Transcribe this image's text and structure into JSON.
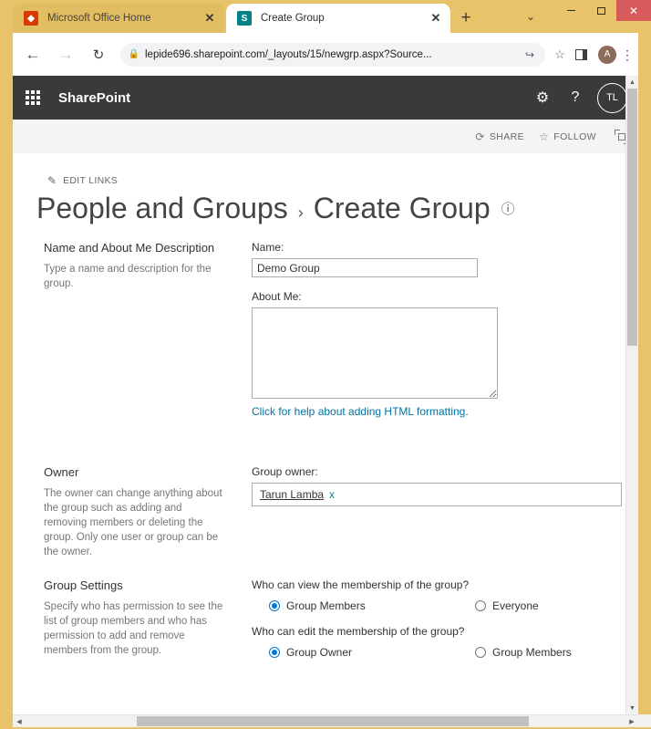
{
  "window": {
    "minimize_label": "—",
    "maximize_label": "□",
    "close_label": "✕"
  },
  "tabs": [
    {
      "title": "Microsoft Office Home",
      "favicon": "office-icon",
      "favicon_letter": "◆",
      "close_label": "✕",
      "active": false
    },
    {
      "title": "Create Group",
      "favicon": "sharepoint-icon",
      "favicon_letter": "S",
      "close_label": "✕",
      "active": true
    }
  ],
  "tabstrip": {
    "new_tab_label": "+",
    "tab_list_label": "⌄"
  },
  "toolbar": {
    "back_label": "←",
    "forward_label": "→",
    "reload_label": "↻",
    "lock_label": "🔒",
    "url": "lepide696.sharepoint.com/_layouts/15/newgrp.aspx?Source...",
    "share_label": "↪",
    "star_label": "☆",
    "profile_initial": "A",
    "kebab_label": "⋮"
  },
  "suitebar": {
    "brand": "SharePoint",
    "settings_label": "⚙",
    "help_label": "?",
    "user_initials": "TL"
  },
  "ribbon": {
    "share": {
      "glyph": "⟳",
      "label": "SHARE"
    },
    "follow": {
      "glyph": "☆",
      "label": "FOLLOW"
    },
    "focus_name": "focus-on-content"
  },
  "page": {
    "edit_links": {
      "icon": "✎",
      "label": "EDIT LINKS"
    },
    "title": {
      "crumb1": "People and Groups",
      "separator": "›",
      "crumb2": "Create Group",
      "info_label": "ⓘ"
    }
  },
  "sections": {
    "name_about": {
      "heading": "Name and About Me Description",
      "description": "Type a name and description for the group.",
      "name_label": "Name:",
      "name_value": "Demo Group",
      "name_placeholder": "",
      "about_label": "About Me:",
      "about_value": "",
      "about_placeholder": "",
      "help_link": "Click for help about adding HTML formatting."
    },
    "owner": {
      "heading": "Owner",
      "description": "The owner can change anything about the group such as adding and removing members or deleting the group. Only one user or group can be the owner.",
      "field_label": "Group owner:",
      "owner_name": "Tarun Lamba",
      "remove_label": "x"
    },
    "group_settings": {
      "heading": "Group Settings",
      "description": "Specify who has permission to see the list of group members and who has permission to add and remove members from the group.",
      "view_question": "Who can view the membership of the group?",
      "view_options": [
        {
          "label": "Group Members",
          "selected": true
        },
        {
          "label": "Everyone",
          "selected": false
        }
      ],
      "edit_question": "Who can edit the membership of the group?",
      "edit_options": [
        {
          "label": "Group Owner",
          "selected": true
        },
        {
          "label": "Group Members",
          "selected": false
        }
      ]
    }
  },
  "scrollbars": {
    "v_up": "▲",
    "v_down": "▼",
    "h_left": "◀",
    "h_right": "▶"
  },
  "colors": {
    "window_frame": "#e8c36a",
    "suitebar": "#3b3a39",
    "accent_blue": "#0078d4",
    "link_teal": "#0072a3",
    "close_red": "#d85b5b"
  }
}
